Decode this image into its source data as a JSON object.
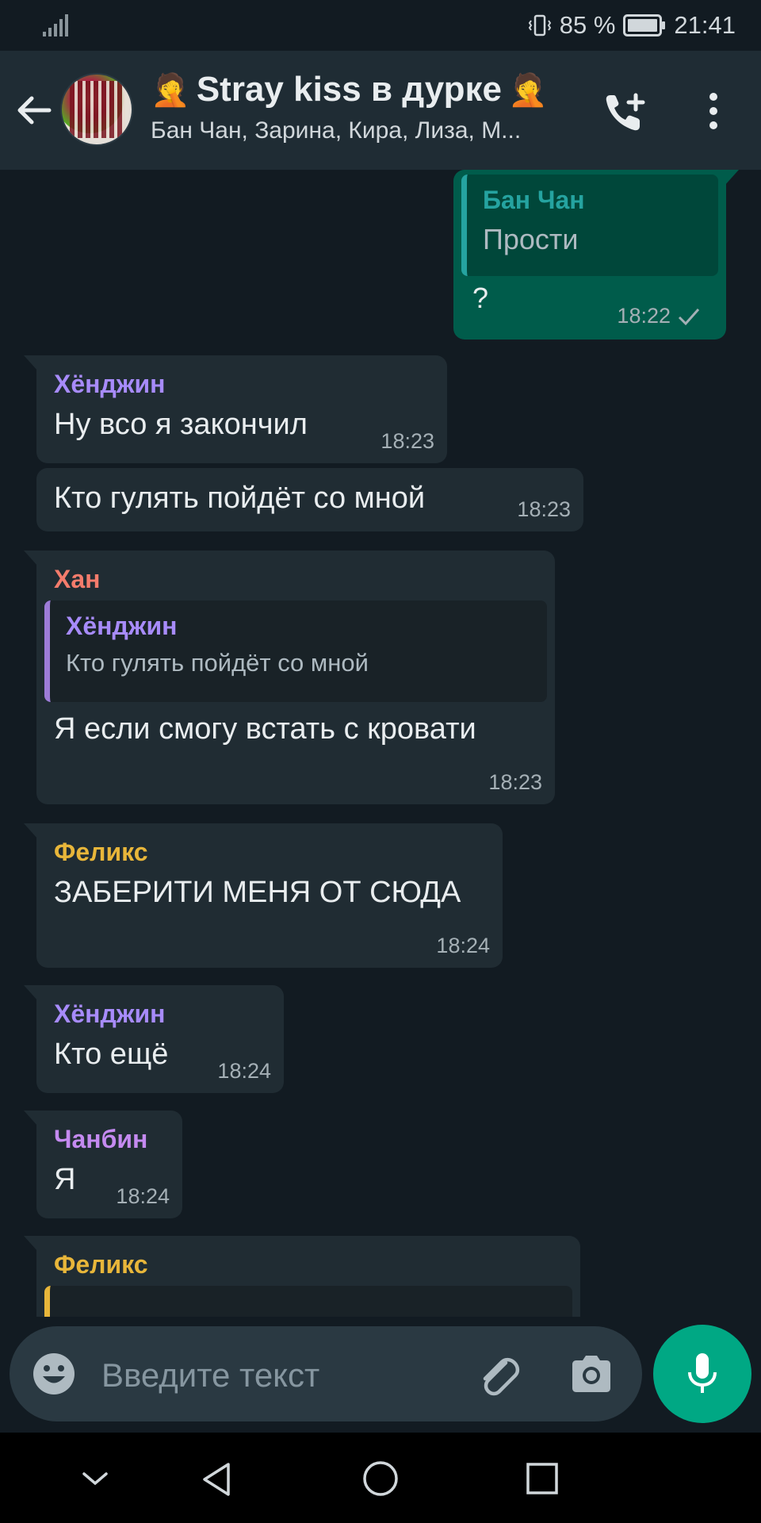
{
  "status_bar": {
    "battery_percent": "85 %",
    "time": "21:41"
  },
  "header": {
    "title": "Stray kiss в дурке",
    "title_emoji_left": "🤦",
    "title_emoji_right": "🤦",
    "subtitle": "Бан Чан, Зарина, Кира, Лиза, М..."
  },
  "messages": [
    {
      "direction": "out",
      "quote_name": "Бан Чан",
      "quote_text": "Прости",
      "text": "?",
      "time": "18:22",
      "status": "sent"
    },
    {
      "direction": "in",
      "sender": "Хёнджин",
      "sender_color": "#a78bfa",
      "text": "Ну всо я закончил",
      "time": "18:23"
    },
    {
      "direction": "in",
      "text": "Кто гулять пойдёт со мной",
      "time": "18:23"
    },
    {
      "direction": "in",
      "sender": "Хан",
      "sender_color": "#f47c6c",
      "quote_name": "Хёнджин",
      "quote_text": "Кто гулять пойдёт со мной",
      "text": "Я если смогу встать с кровати",
      "time": "18:23"
    },
    {
      "direction": "in",
      "sender": "Феликс",
      "sender_color": "#e8b63a",
      "text": "ЗАБЕРИТИ МЕНЯ ОТ СЮДА",
      "time": "18:24"
    },
    {
      "direction": "in",
      "sender": "Хёнджин",
      "sender_color": "#a78bfa",
      "text": "Кто ещё",
      "time": "18:24"
    },
    {
      "direction": "in",
      "sender": "Чанбин",
      "sender_color": "#c48af0",
      "text": "Я",
      "time": "18:24"
    },
    {
      "direction": "in",
      "sender": "Феликс",
      "sender_color": "#e8b63a",
      "partial": true
    }
  ],
  "input": {
    "placeholder": "Введите текст"
  },
  "colors": {
    "accent": "#00a884",
    "outgoing_bubble": "#005c4b",
    "incoming_bubble": "#202c33",
    "background": "#121b22"
  },
  "icons": [
    "back-arrow-icon",
    "add-call-icon",
    "more-vertical-icon",
    "scroll-down-icon",
    "emoji-icon",
    "attach-icon",
    "camera-icon",
    "mic-icon",
    "nav-collapse-icon",
    "nav-back-icon",
    "nav-home-icon",
    "nav-recents-icon"
  ]
}
